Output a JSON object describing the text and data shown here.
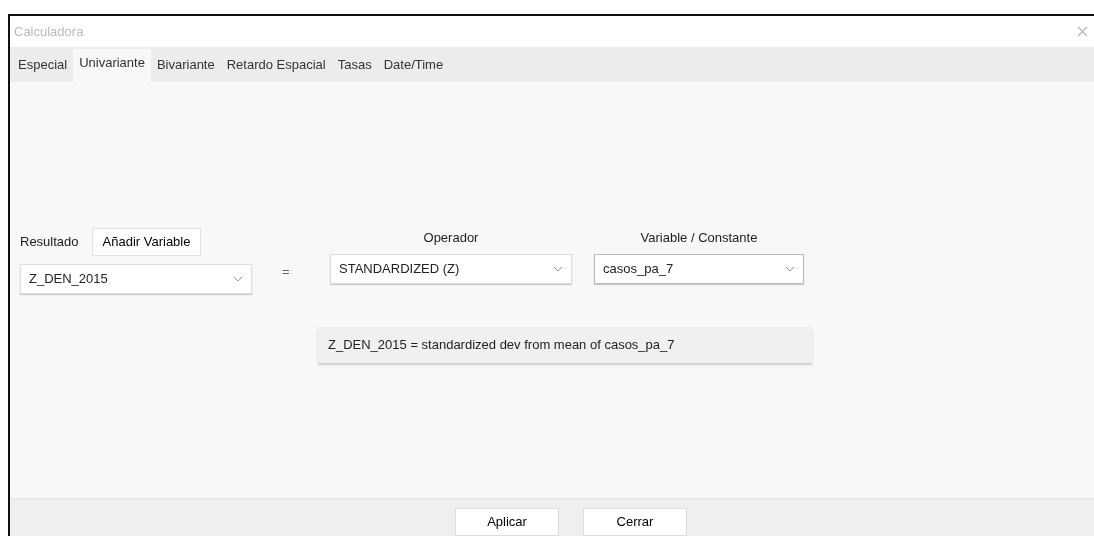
{
  "window": {
    "title": "Calculadora"
  },
  "tabs": [
    {
      "label": "Especial",
      "selected": false
    },
    {
      "label": "Univariante",
      "selected": true
    },
    {
      "label": "Bivariante",
      "selected": false
    },
    {
      "label": "Retardo Espacial",
      "selected": false
    },
    {
      "label": "Tasas",
      "selected": false
    },
    {
      "label": "Date/Time",
      "selected": false
    }
  ],
  "result": {
    "label": "Resultado",
    "add_button": "Añadir Variable",
    "value": "Z_DEN_2015"
  },
  "equals": "=",
  "operator": {
    "label": "Operador",
    "value": "STANDARDIZED (Z)"
  },
  "variable": {
    "label": "Variable / Constante",
    "value": "casos_pa_7"
  },
  "expression": "Z_DEN_2015 = standardized dev from mean of casos_pa_7",
  "buttons": [
    "Aplicar",
    "Cerrar"
  ]
}
